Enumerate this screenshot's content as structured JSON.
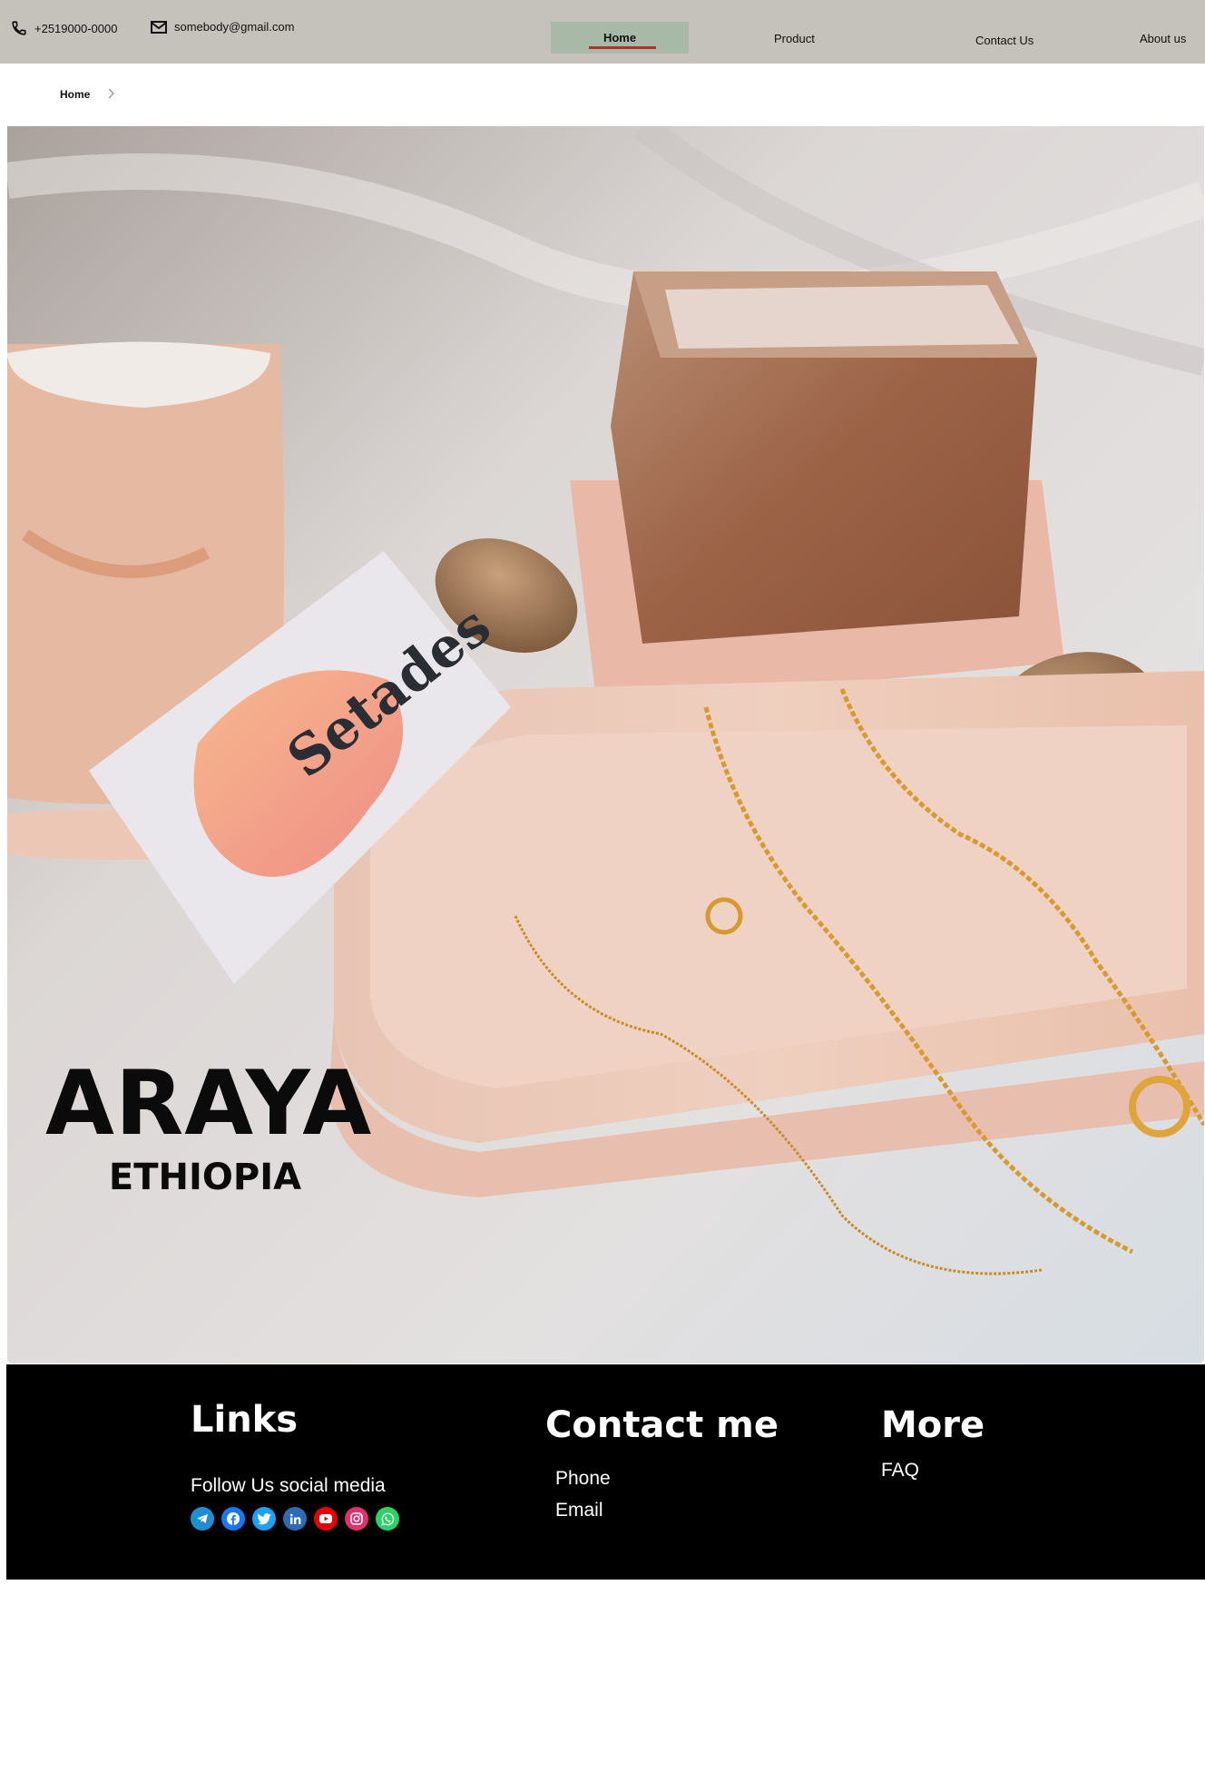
{
  "topbar": {
    "phone": "+2519000-0000",
    "email": "somebody@gmail.com",
    "icons": {
      "phone": "phone-icon",
      "email": "mail-icon"
    },
    "nav": [
      {
        "label": "Home",
        "active": true
      },
      {
        "label": "Product",
        "active": false
      },
      {
        "label": "Contact Us",
        "active": false
      },
      {
        "label": "About us",
        "active": false
      }
    ],
    "colors": {
      "background": "#c5c1bb",
      "active_tab": "#a9b9a8",
      "active_underline": "#b0322c"
    }
  },
  "breadcrumb": {
    "items": [
      "Home"
    ],
    "separator_icon": "chevron-right-icon"
  },
  "hero": {
    "title": "ARAYA",
    "subtitle": "ETHIOPIA",
    "card_text": "Setades",
    "image_description_icon": "product-photo"
  },
  "footer": {
    "background": "#000000",
    "links": {
      "heading": "Links",
      "follow_text": "Follow Us social media"
    },
    "socials": [
      {
        "name": "telegram-icon",
        "color": "#1e8ed2"
      },
      {
        "name": "facebook-icon",
        "color": "#1877f2"
      },
      {
        "name": "twitter-icon",
        "color": "#1da1f2"
      },
      {
        "name": "linkedin-icon",
        "color": "#2d6cb5"
      },
      {
        "name": "youtube-icon",
        "color": "#e60000"
      },
      {
        "name": "instagram-icon",
        "color": "#e1306c"
      },
      {
        "name": "whatsapp-icon",
        "color": "#25d366"
      }
    ],
    "contact": {
      "heading": "Contact me",
      "items": [
        "Phone",
        "Email"
      ]
    },
    "more": {
      "heading": "More",
      "items": [
        "FAQ"
      ]
    }
  }
}
